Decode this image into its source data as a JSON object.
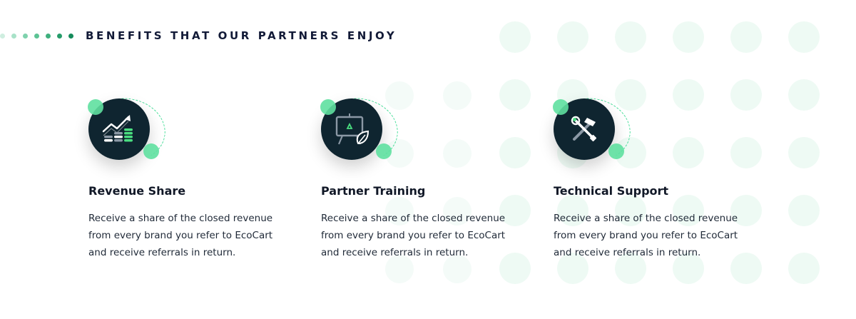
{
  "header": {
    "title": "BENEFITS THAT OUR PARTNERS ENJOY",
    "dot_colors": [
      "#cfeee0",
      "#a8e2c8",
      "#7fd2ad",
      "#5cc394",
      "#3fb07e",
      "#269c6a",
      "#158b5b"
    ]
  },
  "colors": {
    "disc": "#0f2530",
    "accent": "#5fe0a0",
    "heading": "#121a37",
    "bg_dot": "#eefaf4"
  },
  "benefits": [
    {
      "icon": "revenue-chart-icon",
      "title": "Revenue Share",
      "text": "Receive a share of the closed revenue from every brand you refer to EcoCart and receive referrals in return."
    },
    {
      "icon": "training-board-icon",
      "title": "Partner Training",
      "text": "Receive a share of the closed revenue from every brand you refer to EcoCart and receive referrals in return."
    },
    {
      "icon": "tools-icon",
      "title": "Technical Support",
      "text": "Receive a share of the closed revenue from every brand you refer to EcoCart and receive referrals in return."
    }
  ]
}
